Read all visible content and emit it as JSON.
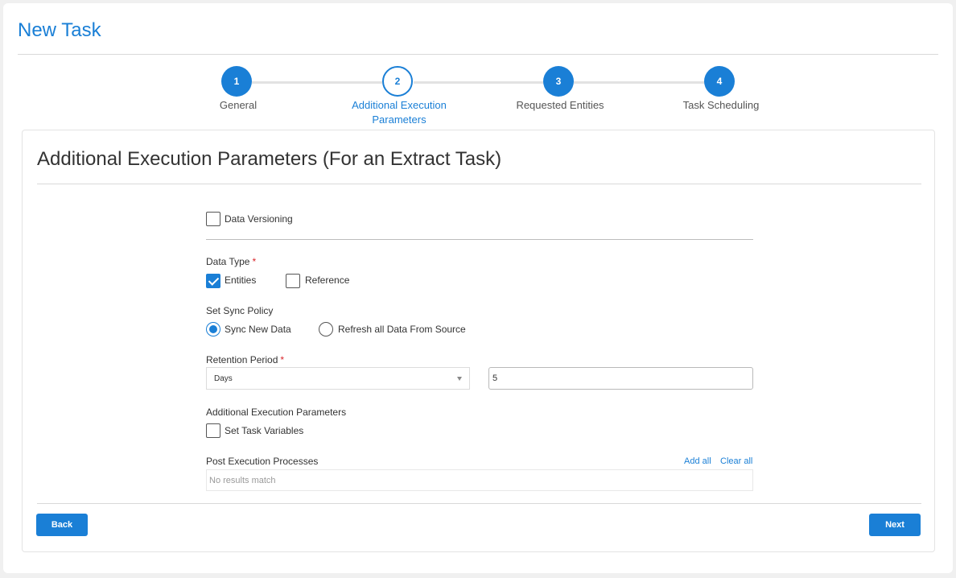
{
  "page": {
    "title": "New Task"
  },
  "stepper": {
    "steps": [
      {
        "number": "1",
        "label": "General",
        "state": "complete"
      },
      {
        "number": "2",
        "label": "Additional Execution Parameters",
        "state": "active"
      },
      {
        "number": "3",
        "label": "Requested Entities",
        "state": "complete"
      },
      {
        "number": "4",
        "label": "Task Scheduling",
        "state": "complete"
      }
    ]
  },
  "section": {
    "title": "Additional Execution Parameters (For an Extract Task)"
  },
  "form": {
    "data_versioning": {
      "label": "Data Versioning",
      "checked": false
    },
    "data_type": {
      "label": "Data Type",
      "required_mark": "*",
      "options": [
        {
          "label": "Entities",
          "checked": true
        },
        {
          "label": "Reference",
          "checked": false
        }
      ]
    },
    "sync_policy": {
      "label": "Set Sync Policy",
      "options": [
        {
          "label": "Sync New Data",
          "selected": true
        },
        {
          "label": "Refresh all Data From Source",
          "selected": false
        }
      ]
    },
    "retention_period": {
      "label": "Retention Period",
      "required_mark": "*",
      "unit_value": "Days",
      "amount_value": "5"
    },
    "additional_params": {
      "label": "Additional Execution Parameters",
      "set_task_variables": {
        "label": "Set Task Variables",
        "checked": false
      }
    },
    "post_execution": {
      "label": "Post Execution Processes",
      "add_all": "Add all",
      "clear_all": "Clear all",
      "empty_text": "No results match"
    }
  },
  "footer": {
    "back_label": "Back",
    "next_label": "Next"
  },
  "colors": {
    "accent": "#1a7fd6",
    "required": "#d9252a"
  }
}
